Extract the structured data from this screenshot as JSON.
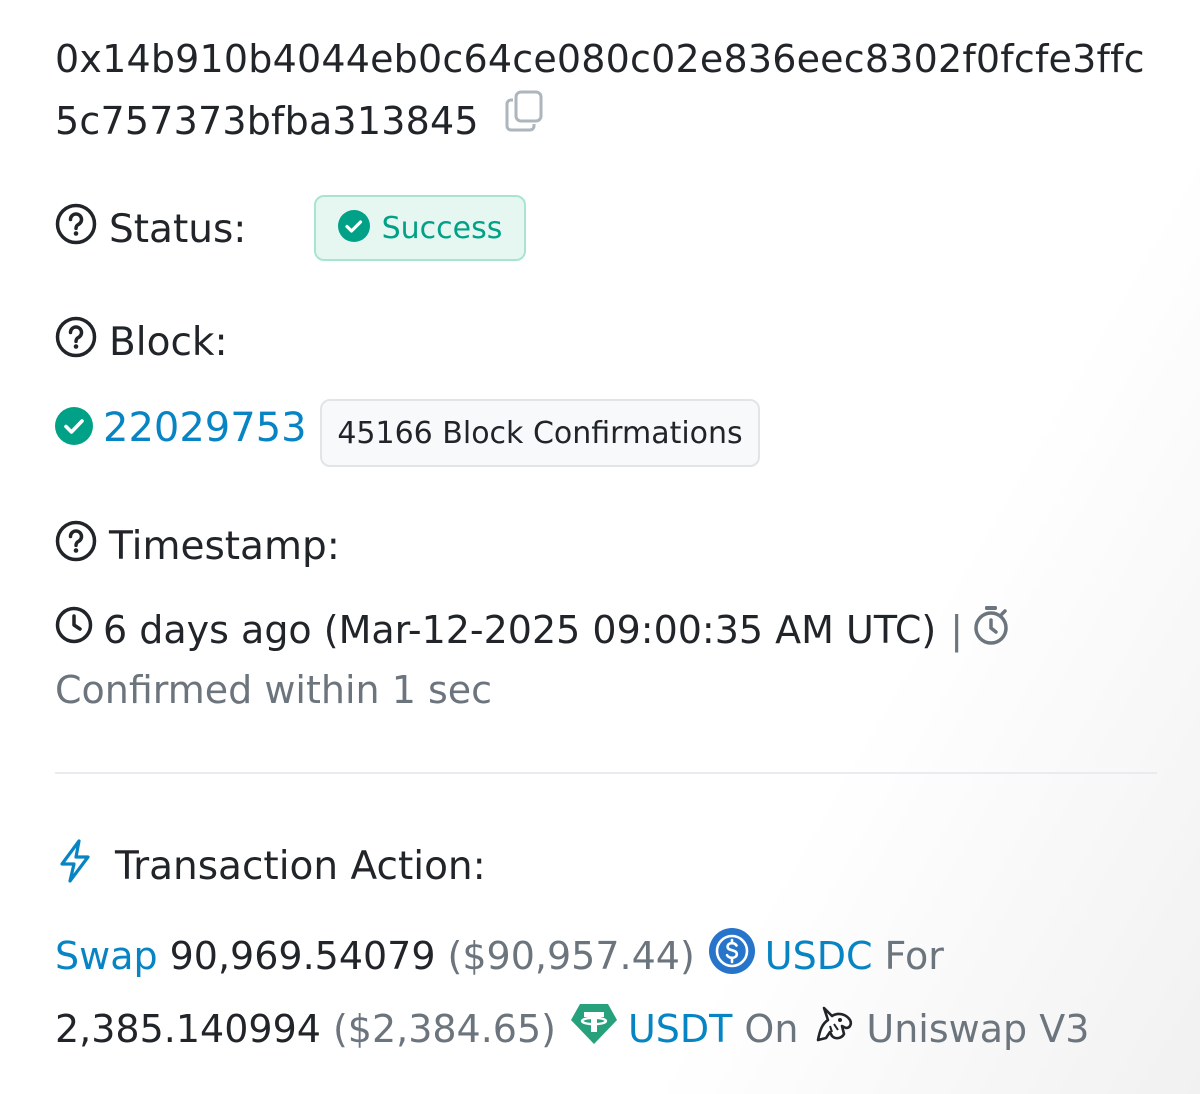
{
  "tx": {
    "hash_line1": "0x14b910b4044eb0c64ce080c02e836eec8302f0fcfe3ffc",
    "hash_line2": "5c757373bfba313845"
  },
  "status": {
    "label": "Status:",
    "value": "Success",
    "color": "#00a186"
  },
  "block": {
    "label": "Block:",
    "number": "22029753",
    "confirmations": "45166 Block Confirmations"
  },
  "timestamp": {
    "label": "Timestamp:",
    "relative": "6 days ago (Mar-12-2025 09:00:35 AM UTC)",
    "separator": "|",
    "confirmed": "Confirmed within 1 sec"
  },
  "action": {
    "label": "Transaction Action:",
    "verb": "Swap",
    "amount_in": "90,969.54079",
    "usd_in": "($90,957.44)",
    "token_in": "USDC",
    "for_word": "For",
    "amount_out": "2,385.140994",
    "usd_out": "($2,384.65)",
    "token_out": "USDT",
    "on_word": "On",
    "dex": "Uniswap V3"
  },
  "colors": {
    "link": "#0784c3",
    "success": "#00a186",
    "usdc": "#2775ca",
    "usdt": "#26a17b"
  }
}
